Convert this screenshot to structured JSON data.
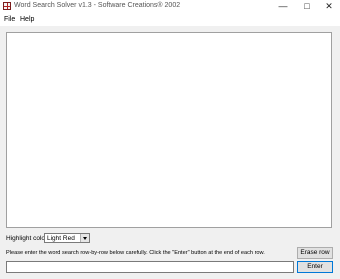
{
  "window": {
    "title": "Word Search Solver v1.3 - Software Creations® 2002",
    "minimize_glyph": "—",
    "maximize_glyph": "□",
    "close_glyph": "✕"
  },
  "menu": {
    "items": [
      "File",
      "Help"
    ]
  },
  "controls": {
    "highlight_label": "Highlight color:",
    "highlight_value": "Light Red",
    "instructions": "Please enter the word search row-by-row below carefully. Click the \"Enter\" button at the end of each row.",
    "erase_row_label": "Erase row",
    "enter_label": "Enter",
    "row_input_value": ""
  },
  "icons": {
    "app": "word-search-app-icon",
    "dropdown": "chevron-down-icon"
  }
}
